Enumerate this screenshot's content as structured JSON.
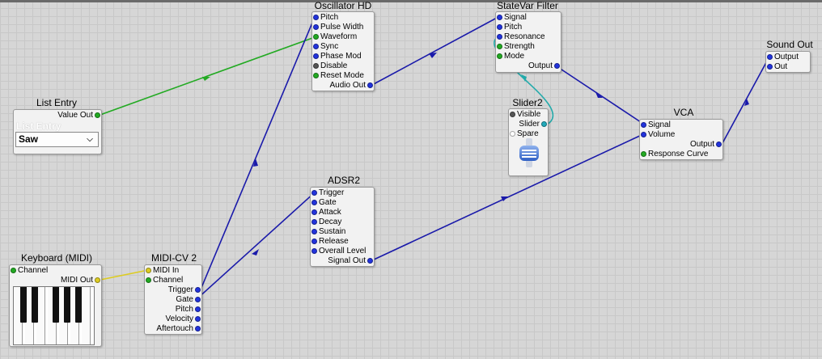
{
  "nodes": {
    "oscillator": {
      "title": "Oscillator HD",
      "inputs": [
        "Pitch",
        "Pulse Width",
        "Waveform",
        "Sync",
        "Phase Mod",
        "Disable",
        "Reset Mode"
      ],
      "outputs": [
        "Audio Out"
      ]
    },
    "statevar_filter": {
      "title": "StateVar Filter",
      "inputs": [
        "Signal",
        "Pitch",
        "Resonance",
        "Strength",
        "Mode"
      ],
      "outputs": [
        "Output"
      ]
    },
    "sound_out": {
      "title": "Sound Out",
      "inputs": [
        "Output",
        "Out"
      ]
    },
    "list_entry": {
      "title": "List Entry",
      "outputs": [
        "Value Out"
      ],
      "panel_label": "List Entry",
      "selected": "Saw"
    },
    "slider2": {
      "title": "Slider2",
      "inputs": [
        "Visible"
      ],
      "outputs": [
        "Slider"
      ],
      "inputs2": [
        "Spare"
      ]
    },
    "vca": {
      "title": "VCA",
      "inputs": [
        "Signal",
        "Volume"
      ],
      "outputs": [
        "Output"
      ],
      "inputs2": [
        "Response Curve"
      ]
    },
    "adsr2": {
      "title": "ADSR2",
      "inputs": [
        "Trigger",
        "Gate",
        "Attack",
        "Decay",
        "Sustain",
        "Release",
        "Overall Level"
      ],
      "outputs": [
        "Signal Out"
      ]
    },
    "keyboard": {
      "title": "Keyboard (MIDI)",
      "inputs": [
        "Channel"
      ],
      "outputs": [
        "MIDI Out"
      ]
    },
    "midi_cv2": {
      "title": "MIDI-CV 2",
      "inputs": [
        "MIDI In",
        "Channel"
      ],
      "outputs": [
        "Trigger",
        "Gate",
        "Pitch",
        "Velocity",
        "Aftertouch"
      ]
    }
  },
  "colors": {
    "canvas": "#d6d6d6",
    "wire_blue": "#1a1aaa",
    "wire_green": "#22aa22",
    "wire_yellow": "#ddcc22",
    "wire_teal": "#22aaaa"
  }
}
